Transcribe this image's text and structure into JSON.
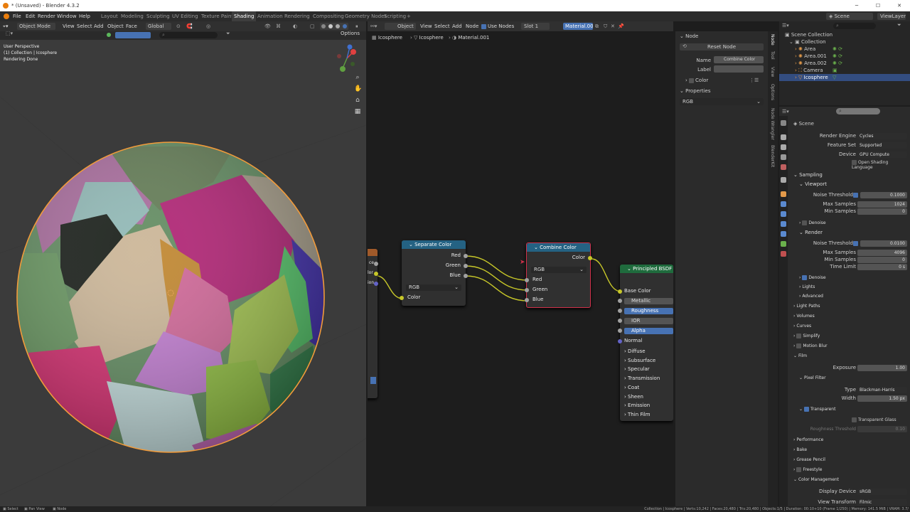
{
  "window": {
    "title": "* (Unsaved) - Blender 4.3.2"
  },
  "menu": [
    "File",
    "Edit",
    "Render",
    "Window",
    "Help"
  ],
  "workspaces": [
    "Layout",
    "Modeling",
    "Sculpting",
    "UV Editing",
    "Texture Paint",
    "Shading",
    "Animation",
    "Rendering",
    "Compositing",
    "Geometry Nodes",
    "Scripting",
    "+"
  ],
  "active_workspace": "Shading",
  "scene": {
    "name": "Scene",
    "view_layer": "ViewLayer"
  },
  "viewport": {
    "header": {
      "mode": "Object Mode",
      "view": "View",
      "select": "Select",
      "add": "Add",
      "object": "Object",
      "face": "Face",
      "orientation": "Global",
      "options": "Options"
    },
    "overlay_text": [
      "User Perspective",
      "(1) Collection | Icosphere",
      "Rendering Done"
    ]
  },
  "node_editor": {
    "header": {
      "object_type": "Object",
      "view": "View",
      "select": "Select",
      "add": "Add",
      "node": "Node",
      "use_nodes": "Use Nodes",
      "slot": "Slot 1",
      "material": "Material.001"
    },
    "breadcrumb": [
      "Icosphere",
      "Icosphere",
      "Material.001"
    ],
    "partial_node": {
      "labels": [
        "ce",
        "lor",
        "ion"
      ]
    },
    "nodes": {
      "separate": {
        "title": "Separate Color",
        "outputs": [
          "Red",
          "Green",
          "Blue"
        ],
        "mode": "RGB",
        "input": "Color"
      },
      "combine": {
        "title": "Combine Color",
        "output": "Color",
        "mode": "RGB",
        "inputs": [
          "Red",
          "Green",
          "Blue"
        ]
      },
      "bsdf": {
        "title": "Principled BSDF",
        "inputs": [
          "Base Color",
          "Metallic",
          "Roughness",
          "IOR",
          "Alpha",
          "Normal"
        ],
        "panels": [
          "Diffuse",
          "Subsurface",
          "Specular",
          "Transmission",
          "Coat",
          "Sheen",
          "Emission",
          "Thin Film"
        ]
      }
    }
  },
  "side_panel": {
    "section": "Node",
    "reset": "Reset Node",
    "name_label": "Name",
    "name_value": "Combine Color",
    "label_label": "Label",
    "label_value": "",
    "color": "Color",
    "properties": "Properties",
    "mode": "RGB",
    "tabs": [
      "Node",
      "Tool",
      "View",
      "Options",
      "Node Wrangler",
      "BlenderKit"
    ]
  },
  "outliner": {
    "items": [
      {
        "name": "Scene Collection",
        "indent": 0
      },
      {
        "name": "Collection",
        "indent": 1
      },
      {
        "name": "Area",
        "indent": 2
      },
      {
        "name": "Area.001",
        "indent": 2
      },
      {
        "name": "Area.002",
        "indent": 2
      },
      {
        "name": "Camera",
        "indent": 2
      },
      {
        "name": "Icosphere",
        "indent": 2,
        "selected": true
      }
    ]
  },
  "properties": {
    "scene_label": "Scene",
    "render_engine": {
      "label": "Render Engine",
      "value": "Cycles"
    },
    "feature_set": {
      "label": "Feature Set",
      "value": "Supported"
    },
    "device": {
      "label": "Device",
      "value": "GPU Compute"
    },
    "osl": "Open Shading Language",
    "sampling": "Sampling",
    "viewport": "Viewport",
    "vp_noise": {
      "label": "Noise Threshold",
      "value": "0.1000"
    },
    "vp_max": {
      "label": "Max Samples",
      "value": "1024"
    },
    "vp_min": {
      "label": "Min Samples",
      "value": "0"
    },
    "vp_denoise": "Denoise",
    "render": "Render",
    "r_noise": {
      "label": "Noise Threshold",
      "value": "0.0100"
    },
    "r_max": {
      "label": "Max Samples",
      "value": "4096"
    },
    "r_min": {
      "label": "Min Samples",
      "value": "0"
    },
    "r_time": {
      "label": "Time Limit",
      "value": "0 s"
    },
    "r_denoise": "Denoise",
    "lights": "Lights",
    "advanced": "Advanced",
    "light_paths": "Light Paths",
    "volumes": "Volumes",
    "curves": "Curves",
    "simplify": "Simplify",
    "motion_blur": "Motion Blur",
    "film": "Film",
    "exposure": {
      "label": "Exposure",
      "value": "1.00"
    },
    "pixel_filter": "Pixel Filter",
    "pf_type": {
      "label": "Type",
      "value": "Blackman-Harris"
    },
    "pf_width": {
      "label": "Width",
      "value": "1.50 px"
    },
    "transparent": "Transparent",
    "transparent_glass": "Transparent Glass",
    "roughness_threshold": {
      "label": "Roughness Threshold",
      "value": "0.10"
    },
    "performance": "Performance",
    "bake": "Bake",
    "grease_pencil": "Grease Pencil",
    "freestyle": "Freestyle",
    "color_management": "Color Management",
    "display_device": {
      "label": "Display Device",
      "value": "sRGB"
    },
    "view_transform": {
      "label": "View Transform",
      "value": "Filmic"
    }
  },
  "statusbar": {
    "left": [
      "Select",
      "Pan View",
      "Node"
    ],
    "right": "Collection | Icosphere | Verts:10,242 | Faces:20,480 | Tris:20,480 | Objects:1/5 | Duration: 00:10+10 (Frame 1/250) | Memory: 141.5 MiB | VRAM: 3.7/"
  }
}
